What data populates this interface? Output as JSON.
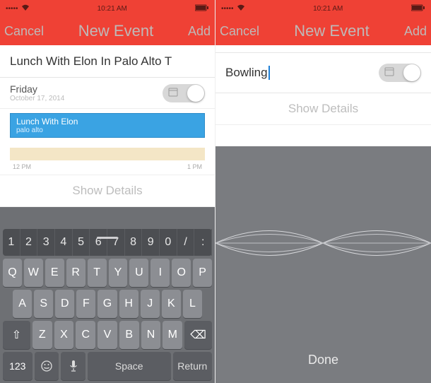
{
  "statusbar": {
    "carrier": "●●●●●",
    "wifi": "wifi",
    "time": "10:21 AM",
    "battery": "batt"
  },
  "left": {
    "nav": {
      "cancel": "Cancel",
      "title": "New Event",
      "add": "Add"
    },
    "event_title": "Lunch With Elon In Palo Alto T",
    "date": {
      "day": "Friday",
      "full": "October 17, 2014"
    },
    "toggle_label": "",
    "chip": {
      "title": "Lunch With Elon",
      "sub": "palo alto"
    },
    "time_start": "12 PM",
    "time_end": "1 PM",
    "show_details": "Show Details",
    "keyboard": {
      "numrow": [
        "1",
        "2",
        "3",
        "4",
        "5",
        "6",
        "7",
        "8",
        "9",
        "0",
        "/",
        ":"
      ],
      "row1": [
        "Q",
        "W",
        "E",
        "R",
        "T",
        "Y",
        "U",
        "I",
        "O",
        "P"
      ],
      "row2": [
        "A",
        "S",
        "D",
        "F",
        "G",
        "H",
        "J",
        "K",
        "L"
      ],
      "row3": [
        "Z",
        "X",
        "C",
        "V",
        "B",
        "N",
        "M"
      ],
      "shift": "⇧",
      "backspace": "⌫",
      "numkey": "123",
      "emoji": "☺",
      "mic": "🎤",
      "space": "Space",
      "ret": "Return"
    }
  },
  "right": {
    "nav": {
      "cancel": "Cancel",
      "title": "New Event",
      "add": "Add"
    },
    "event_title": "Bowling",
    "show_details": "Show Details",
    "done": "Done"
  }
}
